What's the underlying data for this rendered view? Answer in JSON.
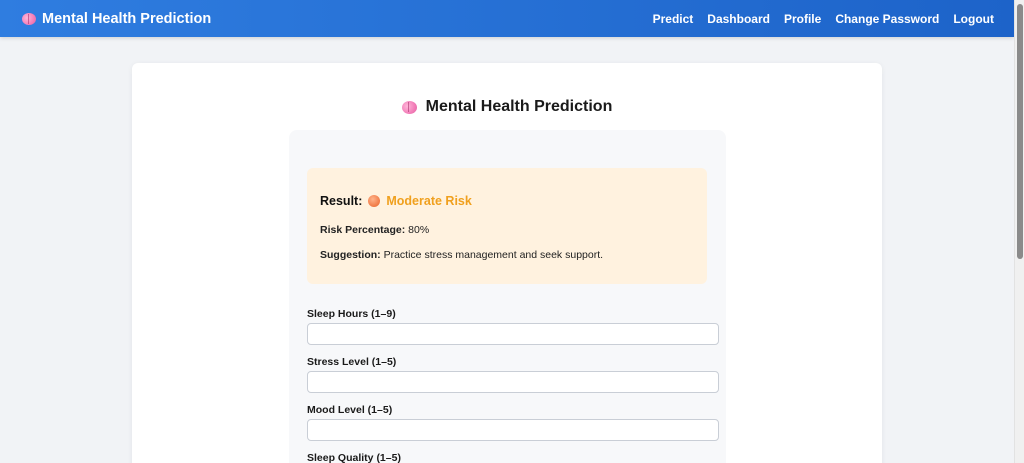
{
  "navbar": {
    "brand": "Mental Health Prediction",
    "links": [
      "Predict",
      "Dashboard",
      "Profile",
      "Change Password",
      "Logout"
    ]
  },
  "page": {
    "title": "Mental Health Prediction"
  },
  "result": {
    "label": "Result:",
    "risk": "Moderate Risk",
    "risk_percentage_label": "Risk Percentage:",
    "risk_percentage_value": "80%",
    "suggestion_label": "Suggestion:",
    "suggestion_value": "Practice stress management and seek support."
  },
  "fields": [
    {
      "label": "Sleep Hours (1–9)",
      "value": "",
      "placeholder": ""
    },
    {
      "label": "Stress Level (1–5)",
      "value": "",
      "placeholder": ""
    },
    {
      "label": "Mood Level (1–5)",
      "value": "",
      "placeholder": ""
    },
    {
      "label": "Sleep Quality (1–5)",
      "value": "",
      "placeholder": ""
    }
  ],
  "colors": {
    "navbar": "#2f7de0",
    "result_bg": "#fff2df",
    "risk_text": "#f0a01e"
  }
}
